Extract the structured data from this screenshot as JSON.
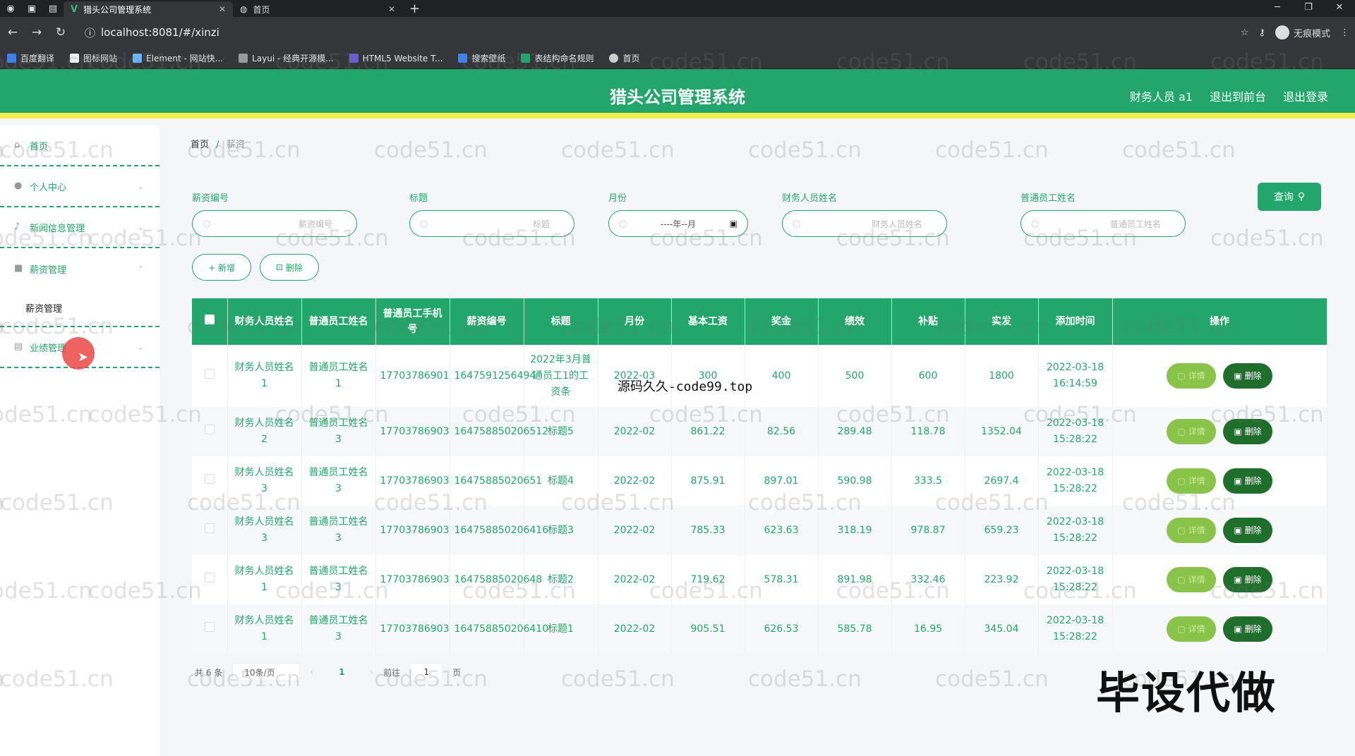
{
  "browser": {
    "tabs": [
      {
        "title": "猎头公司管理系统",
        "active": true
      },
      {
        "title": "首页",
        "active": false
      }
    ],
    "url": "localhost:8081/#/xinzi",
    "incognito_label": "无痕模式",
    "bookmarks": [
      "百度翻译",
      "图标网站",
      "Element - 网站快...",
      "Layui - 经典开源模...",
      "HTML5 Website T...",
      "搜索壁纸",
      "表结构命名规则",
      "首页"
    ]
  },
  "header": {
    "title": "猎头公司管理系统",
    "user": "财务人员 a1",
    "back_front": "退出到前台",
    "logout": "退出登录"
  },
  "sidebar": {
    "items": [
      {
        "label": "首页",
        "icon": "home-icon"
      },
      {
        "label": "个人中心",
        "icon": "user-icon"
      },
      {
        "label": "新闻信息管理",
        "icon": "mic-icon"
      },
      {
        "label": "薪资管理",
        "icon": "briefcase-icon"
      },
      {
        "label": "业绩管理",
        "icon": "document-icon"
      }
    ],
    "submenu": "薪资管理"
  },
  "breadcrumb": {
    "home": "首页",
    "sep": "/",
    "current": "薪资"
  },
  "filters": [
    {
      "label": "薪资编号",
      "placeholder": "薪资编号"
    },
    {
      "label": "标题",
      "placeholder": "标题"
    },
    {
      "label": "月份",
      "placeholder": "----年--月"
    },
    {
      "label": "财务人员姓名",
      "placeholder": "财务人员姓名"
    },
    {
      "label": "普通员工姓名",
      "placeholder": "普通员工姓名"
    }
  ],
  "actions": {
    "query": "查询",
    "add": "+ 新增",
    "delete": "删除"
  },
  "table": {
    "headers": [
      "财务人员姓名",
      "普通员工姓名",
      "普通员工手机号",
      "薪资编号",
      "标题",
      "月份",
      "基本工资",
      "奖金",
      "绩效",
      "补贴",
      "实发",
      "添加时间",
      "操作"
    ],
    "detail_label": "详情",
    "delete_label": "删除",
    "rows": [
      [
        "财务人员姓名1",
        "普通员工姓名1",
        "17703786901",
        "1647591256494",
        "2022年3月普通员工1的工资条",
        "2022-03",
        "300",
        "400",
        "500",
        "600",
        "1800",
        "2022-03-18 16:14:59"
      ],
      [
        "财务人员姓名2",
        "普通员工姓名3",
        "17703786903",
        "164758850206512",
        "标题5",
        "2022-02",
        "861.22",
        "82.56",
        "289.48",
        "118.78",
        "1352.04",
        "2022-03-18 15:28:22"
      ],
      [
        "财务人员姓名3",
        "普通员工姓名3",
        "17703786903",
        "16475885020651",
        "标题4",
        "2022-02",
        "875.91",
        "897.01",
        "590.98",
        "333.5",
        "2697.4",
        "2022-03-18 15:28:22"
      ],
      [
        "财务人员姓名3",
        "普通员工姓名3",
        "17703786903",
        "164758850206416",
        "标题3",
        "2022-02",
        "785.33",
        "623.63",
        "318.19",
        "978.87",
        "659.23",
        "2022-03-18 15:28:22"
      ],
      [
        "财务人员姓名1",
        "普通员工姓名3",
        "17703786903",
        "16475885020648",
        "标题2",
        "2022-02",
        "719.62",
        "578.31",
        "891.98",
        "332.46",
        "223.92",
        "2022-03-18 15:28:22"
      ],
      [
        "财务人员姓名1",
        "普通员工姓名3",
        "17703786903",
        "164758850206410",
        "标题1",
        "2022-02",
        "905.51",
        "626.53",
        "585.78",
        "16.95",
        "345.04",
        "2022-03-18 15:28:22"
      ]
    ]
  },
  "pagination": {
    "total": "共 6 条",
    "page_size": "10条/页",
    "current": "1",
    "goto_prefix": "前往",
    "goto_value": "1",
    "goto_suffix": "页"
  },
  "overlay": {
    "watermark": "code51.cn",
    "source_text": "源码久久-code99.top",
    "big_text": "毕设代做"
  },
  "colors": {
    "primary": "#22a66b",
    "accent_bar": "#f2ec4c",
    "detail_btn": "#8ac34a",
    "delete_btn": "#1f6e2c"
  }
}
